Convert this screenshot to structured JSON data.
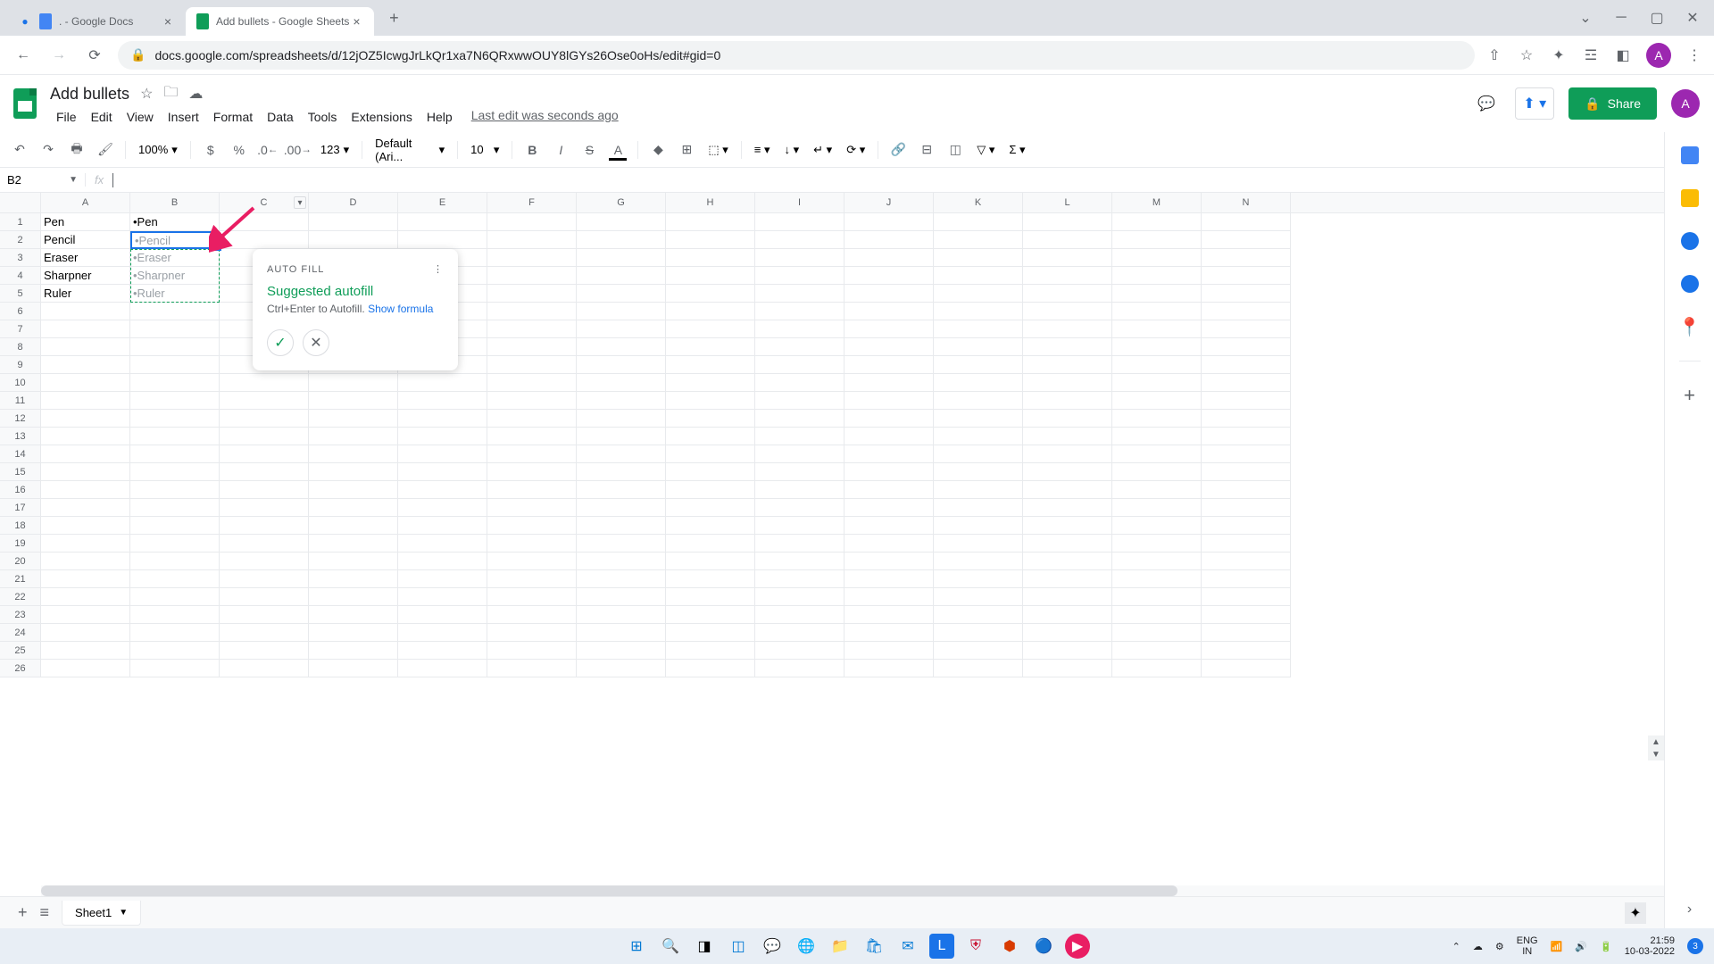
{
  "browser": {
    "tabs": [
      {
        "title": ". - Google Docs"
      },
      {
        "title": "Add bullets - Google Sheets"
      }
    ],
    "url": "docs.google.com/spreadsheets/d/12jOZ5IcwgJrLkQr1xa7N6QRxwwOUY8lGYs26Ose0oHs/edit#gid=0"
  },
  "doc": {
    "title": "Add bullets",
    "menus": [
      "File",
      "Edit",
      "View",
      "Insert",
      "Format",
      "Data",
      "Tools",
      "Extensions",
      "Help"
    ],
    "last_edit": "Last edit was seconds ago",
    "share": "Share"
  },
  "toolbar": {
    "zoom": "100%",
    "currency": "$",
    "percent": "%",
    "dec_less": ".0",
    "dec_more": ".00",
    "num_fmt": "123",
    "font": "Default (Ari...",
    "size": "10"
  },
  "formula": {
    "name_box": "B2",
    "fx": "fx"
  },
  "grid": {
    "cols": [
      "A",
      "B",
      "C",
      "D",
      "E",
      "F",
      "G",
      "H",
      "I",
      "J",
      "K",
      "L",
      "M",
      "N"
    ],
    "rows": 26,
    "data_a": [
      "Pen",
      "Pencil",
      "Eraser",
      "Sharpner",
      "Ruler"
    ],
    "b1": "•Pen",
    "active": "•Pencil",
    "suggest": [
      "•Eraser",
      "•Sharpner",
      "•Ruler"
    ]
  },
  "autofill": {
    "header": "AUTO FILL",
    "title": "Suggested autofill",
    "sub_pre": "Ctrl+Enter to Autofill. ",
    "link": "Show formula"
  },
  "sheet_tab": "Sheet1",
  "taskbar": {
    "lang1": "ENG",
    "lang2": "IN",
    "time": "21:59",
    "date": "10-03-2022",
    "noti": "3"
  }
}
